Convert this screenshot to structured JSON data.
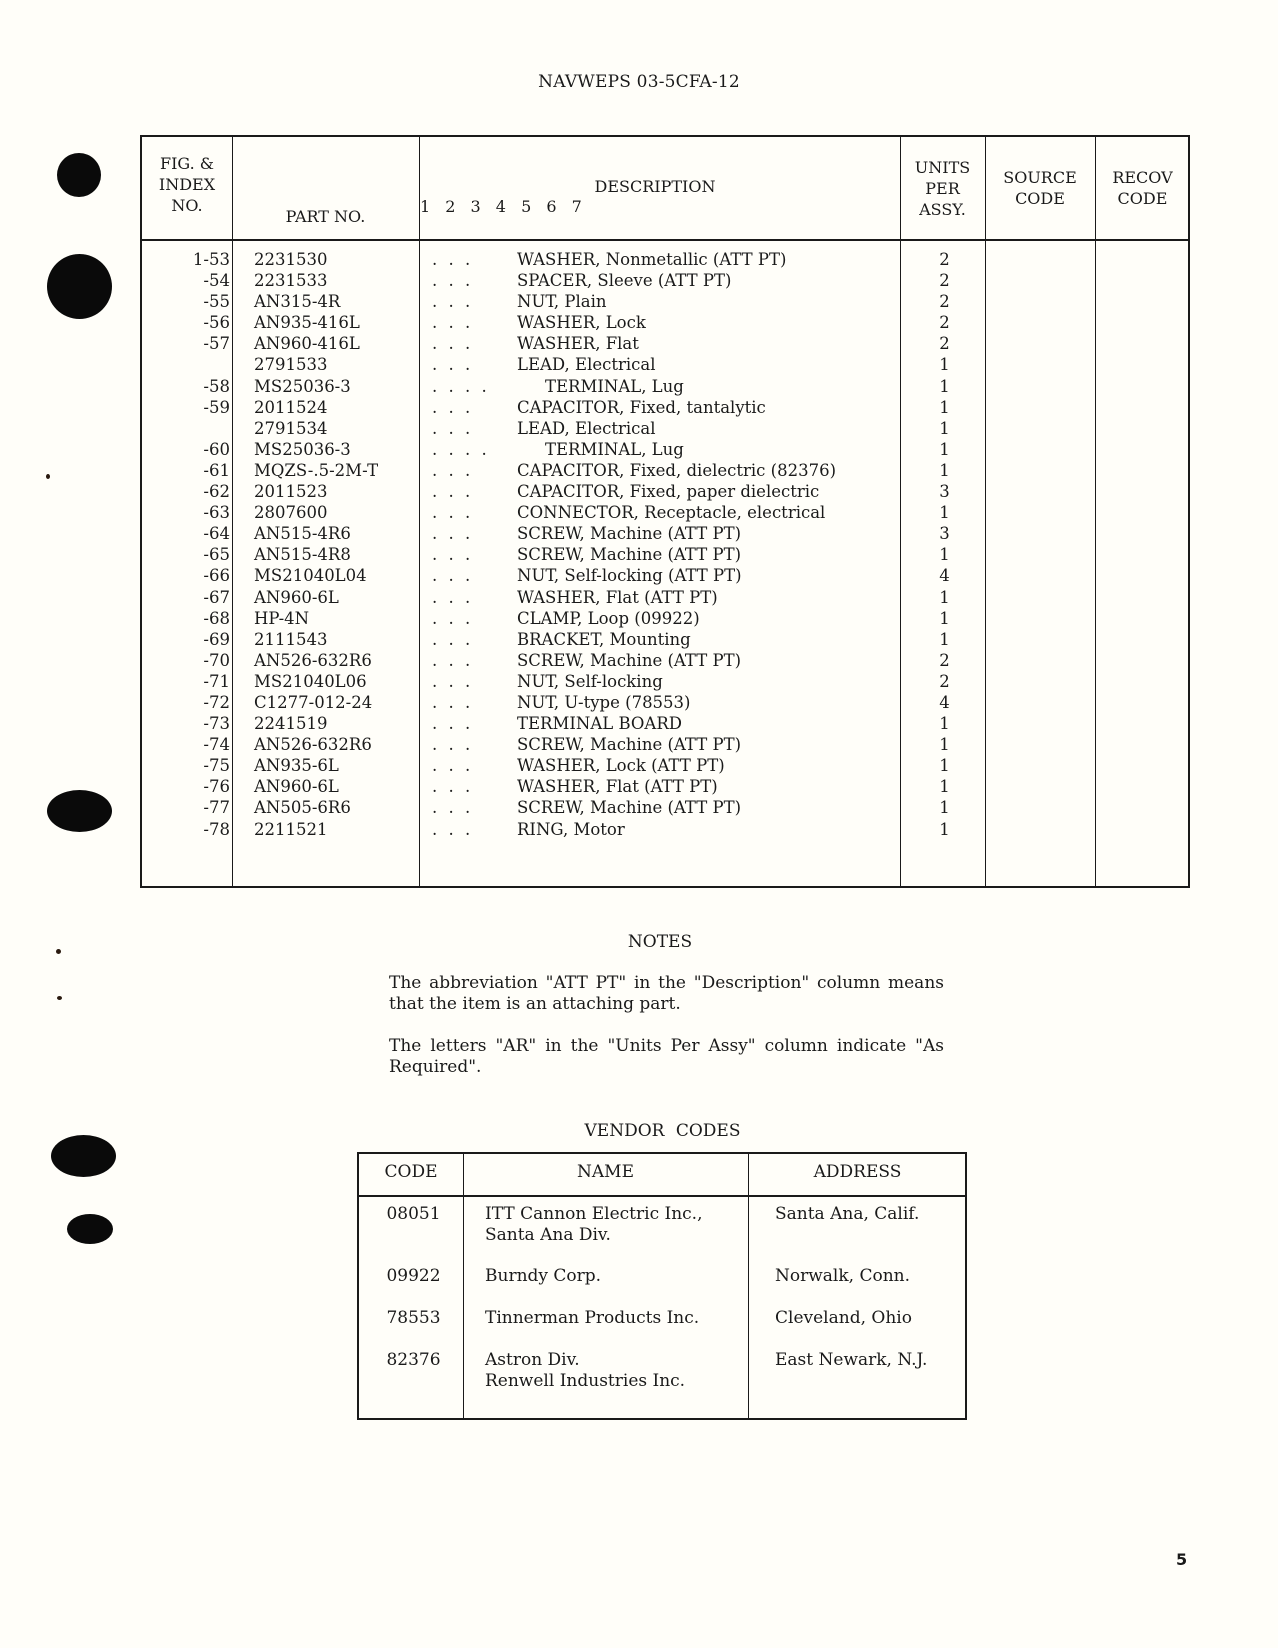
{
  "document_id": "NAVWEPS 03-5CFA-12",
  "parts_table": {
    "headers": {
      "index": "FIG. &\nINDEX\nNO.",
      "part_no": "PART NO.",
      "description": "DESCRIPTION",
      "levels": "1 2 3 4 5 6 7",
      "units": "UNITS\nPER\nASSY.",
      "source": "SOURCE\nCODE",
      "recov": "RECOV\nCODE"
    },
    "rows": [
      {
        "index": "1-53",
        "part_no": "2231530",
        "indent": ". . .",
        "description": "WASHER, Nonmetallic (ATT PT)",
        "units": "2"
      },
      {
        "index": "-54",
        "part_no": "2231533",
        "indent": ". . .",
        "description": "SPACER, Sleeve (ATT PT)",
        "units": "2"
      },
      {
        "index": "-55",
        "part_no": "AN315-4R",
        "indent": ". . .",
        "description": "NUT, Plain",
        "units": "2"
      },
      {
        "index": "-56",
        "part_no": "AN935-416L",
        "indent": ". . .",
        "description": "WASHER, Lock",
        "units": "2"
      },
      {
        "index": "-57",
        "part_no": "AN960-416L",
        "indent": ". . .",
        "description": "WASHER, Flat",
        "units": "2"
      },
      {
        "index": "",
        "part_no": "2791533",
        "indent": ". . .",
        "description": "LEAD, Electrical",
        "units": "1"
      },
      {
        "index": "-58",
        "part_no": "MS25036-3",
        "indent": ". . . .",
        "description": "TERMINAL, Lug",
        "units": "1"
      },
      {
        "index": "-59",
        "part_no": "2011524",
        "indent": ". . .",
        "description": "CAPACITOR, Fixed, tantalytic",
        "units": "1"
      },
      {
        "index": "",
        "part_no": "2791534",
        "indent": ". . .",
        "description": "LEAD, Electrical",
        "units": "1"
      },
      {
        "index": "-60",
        "part_no": "MS25036-3",
        "indent": ". . . .",
        "description": "TERMINAL, Lug",
        "units": "1"
      },
      {
        "index": "-61",
        "part_no": "MQZS-.5-2M-T",
        "indent": ". . .",
        "description": "CAPACITOR, Fixed, dielectric (82376)",
        "units": "1"
      },
      {
        "index": "-62",
        "part_no": "2011523",
        "indent": ". . .",
        "description": "CAPACITOR, Fixed, paper dielectric",
        "units": "3"
      },
      {
        "index": "-63",
        "part_no": "2807600",
        "indent": ". . .",
        "description": "CONNECTOR, Receptacle, electrical",
        "units": "1"
      },
      {
        "index": "-64",
        "part_no": "AN515-4R6",
        "indent": ". . .",
        "description": "SCREW, Machine (ATT PT)",
        "units": "3"
      },
      {
        "index": "-65",
        "part_no": "AN515-4R8",
        "indent": ". . .",
        "description": "SCREW, Machine (ATT PT)",
        "units": "1"
      },
      {
        "index": "-66",
        "part_no": "MS21040L04",
        "indent": ". . .",
        "description": "NUT, Self-locking (ATT PT)",
        "units": "4"
      },
      {
        "index": "-67",
        "part_no": "AN960-6L",
        "indent": ". . .",
        "description": "WASHER, Flat (ATT PT)",
        "units": "1"
      },
      {
        "index": "-68",
        "part_no": "HP-4N",
        "indent": ". . .",
        "description": "CLAMP, Loop (09922)",
        "units": "1"
      },
      {
        "index": "-69",
        "part_no": "2111543",
        "indent": ". . .",
        "description": "BRACKET, Mounting",
        "units": "1"
      },
      {
        "index": "-70",
        "part_no": "AN526-632R6",
        "indent": ". . .",
        "description": "SCREW, Machine (ATT PT)",
        "units": "2"
      },
      {
        "index": "-71",
        "part_no": "MS21040L06",
        "indent": ". . .",
        "description": "NUT, Self-locking",
        "units": "2"
      },
      {
        "index": "-72",
        "part_no": "C1277-012-24",
        "indent": ". . .",
        "description": "NUT, U-type (78553)",
        "units": "4"
      },
      {
        "index": "-73",
        "part_no": "2241519",
        "indent": ". . .",
        "description": "TERMINAL BOARD",
        "units": "1"
      },
      {
        "index": "-74",
        "part_no": "AN526-632R6",
        "indent": ". . .",
        "description": "SCREW, Machine (ATT PT)",
        "units": "1"
      },
      {
        "index": "-75",
        "part_no": "AN935-6L",
        "indent": ". . .",
        "description": "WASHER, Lock (ATT PT)",
        "units": "1"
      },
      {
        "index": "-76",
        "part_no": "AN960-6L",
        "indent": ". . .",
        "description": "WASHER, Flat (ATT PT)",
        "units": "1"
      },
      {
        "index": "-77",
        "part_no": "AN505-6R6",
        "indent": ". . .",
        "description": "SCREW, Machine (ATT PT)",
        "units": "1"
      },
      {
        "index": "-78",
        "part_no": "2211521",
        "indent": ". . .",
        "description": "RING, Motor",
        "units": "1"
      }
    ]
  },
  "notes": {
    "title": "NOTES",
    "items": [
      "The abbreviation \"ATT PT\" in the \"Description\" column means that the item is an attaching part.",
      "The letters \"AR\" in the \"Units Per Assy\" column indicate \"As Required\"."
    ]
  },
  "vendor_codes": {
    "title": "VENDOR CODES",
    "headers": {
      "code": "CODE",
      "name": "NAME",
      "address": "ADDRESS"
    },
    "rows": [
      {
        "code": "08051",
        "name": "ITT Cannon Electric Inc.,\nSanta Ana Div.",
        "address": "Santa Ana, Calif."
      },
      {
        "code": "09922",
        "name": "Burndy Corp.",
        "address": "Norwalk, Conn."
      },
      {
        "code": "78553",
        "name": "Tinnerman Products Inc.",
        "address": "Cleveland, Ohio"
      },
      {
        "code": "82376",
        "name": "Astron Div.\nRenwell Industries Inc.",
        "address": "East Newark, N.J."
      }
    ]
  },
  "page_number": "5"
}
